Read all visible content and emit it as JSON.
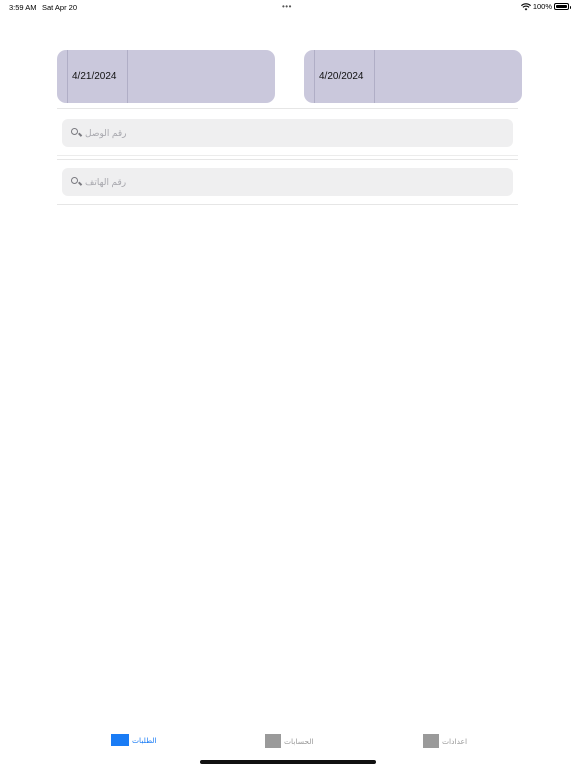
{
  "status_bar": {
    "time": "3:59 AM",
    "date": "Sat Apr 20",
    "dots": "•••",
    "battery": "100%",
    "battery_level": 1.0,
    "icons": [
      "wifi-icon",
      "battery-icon"
    ]
  },
  "date_pickers": {
    "start": "4/21/2024",
    "end": "4/20/2024"
  },
  "search": {
    "receipt_placeholder": "رقم الوصل",
    "phone_placeholder": "رقم الهاتف",
    "icon": "search-icon"
  },
  "tab_bar": {
    "items": [
      {
        "label": "الطلبات",
        "icon": "orders-icon",
        "active": true
      },
      {
        "label": "الحسابات",
        "icon": "accounts-icon",
        "active": false
      },
      {
        "label": "اعدادات",
        "icon": "settings-icon",
        "active": false
      }
    ]
  },
  "colors": {
    "accent": "#1a7cf5",
    "date_button_bg": "#cac8dc",
    "search_field_bg": "#efeff0",
    "inactive_tab": "#9a9a9a"
  }
}
